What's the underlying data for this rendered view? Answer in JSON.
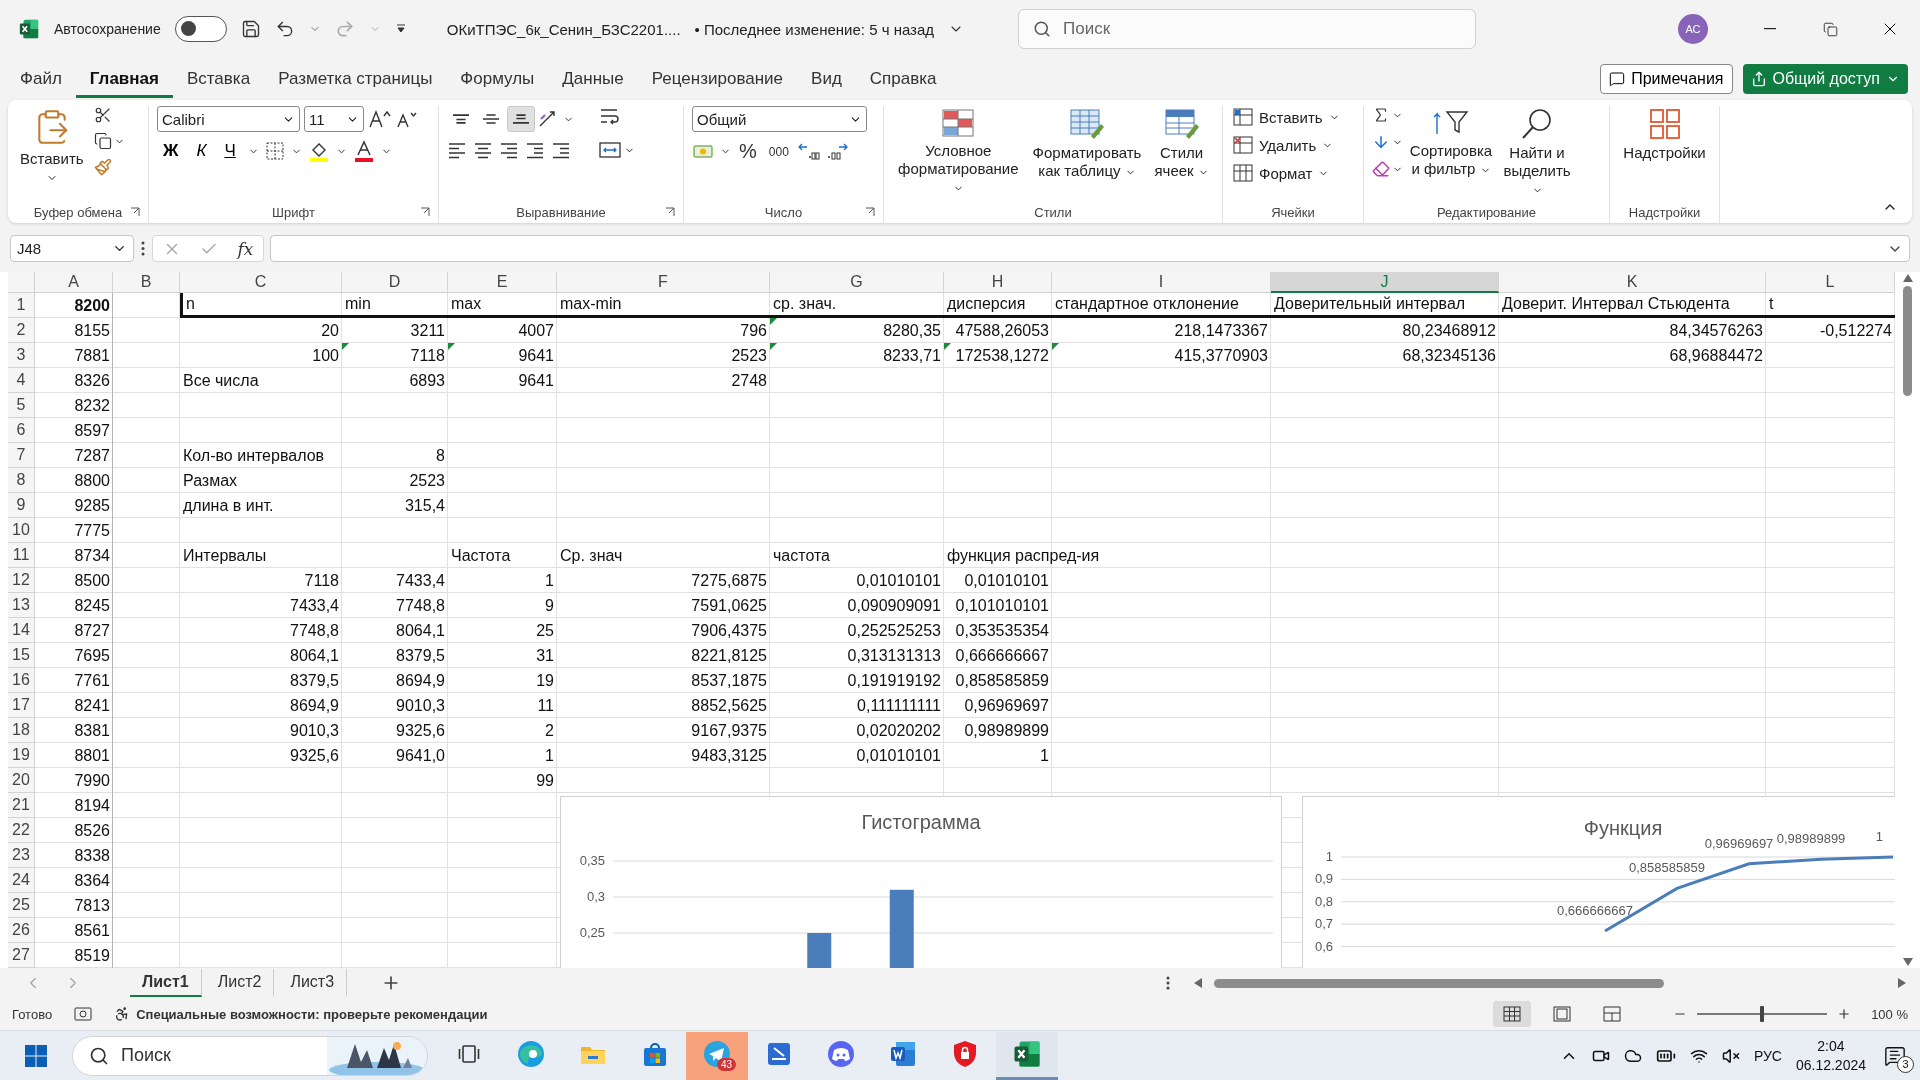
{
  "title_bar": {
    "autosave_label": "Автосохранение",
    "autosave_on": false,
    "document_title": "ОКиТПЭС_6к_Сенин_БЗС2201....",
    "last_modified": "• Последнее изменение: 5 ч назад",
    "search_placeholder": "Поиск",
    "avatar": "АС"
  },
  "menu": {
    "tabs": [
      {
        "label": "Файл",
        "selected": false
      },
      {
        "label": "Главная",
        "selected": true
      },
      {
        "label": "Вставка",
        "selected": false
      },
      {
        "label": "Разметка страницы",
        "selected": false
      },
      {
        "label": "Формулы",
        "selected": false
      },
      {
        "label": "Данные",
        "selected": false
      },
      {
        "label": "Рецензирование",
        "selected": false
      },
      {
        "label": "Вид",
        "selected": false
      },
      {
        "label": "Справка",
        "selected": false
      }
    ],
    "comments_button": "Примечания",
    "share_button": "Общий доступ"
  },
  "ribbon": {
    "clipboard": {
      "label": "Буфер обмена",
      "paste": "Вставить"
    },
    "font": {
      "label": "Шрифт",
      "name": "Calibri",
      "size": "11",
      "bold": "Ж",
      "italic": "К",
      "underline": "Ч"
    },
    "alignment": {
      "label": "Выравнивание",
      "vertical_buttons": [
        {
          "selected": false
        },
        {
          "selected": false
        },
        {
          "selected": true
        }
      ]
    },
    "number": {
      "label": "Число",
      "format": "Общий",
      "percent": "%",
      "thousands": "000"
    },
    "styles": {
      "label": "Стили",
      "buttons": [
        "Условное форматирование",
        "Форматировать как таблицу",
        "Стили ячеек"
      ]
    },
    "cells": {
      "label": "Ячейки",
      "buttons": [
        "Вставить",
        "Удалить",
        "Формат"
      ]
    },
    "editing": {
      "label": "Редактирование",
      "buttons": [
        "Сортировка и фильтр",
        "Найти и выделить"
      ]
    },
    "addins": {
      "label": "Надстройки",
      "button": "Надстройки"
    }
  },
  "formula_bar": {
    "name_box": "J48",
    "function_label": "fx"
  },
  "sheet": {
    "columns": [
      {
        "letter": "A",
        "selected": false
      },
      {
        "letter": "B",
        "selected": false
      },
      {
        "letter": "C",
        "selected": false
      },
      {
        "letter": "D",
        "selected": false
      },
      {
        "letter": "E",
        "selected": false
      },
      {
        "letter": "F",
        "selected": false
      },
      {
        "letter": "G",
        "selected": false
      },
      {
        "letter": "H",
        "selected": false
      },
      {
        "letter": "I",
        "selected": false
      },
      {
        "letter": "J",
        "selected": true
      },
      {
        "letter": "K",
        "selected": false
      },
      {
        "letter": "L",
        "selected": false
      }
    ],
    "rows": [
      {
        "number": "1",
        "header": true,
        "cells": [
          {
            "text": "8200",
            "bold": true
          },
          null,
          "n",
          "min",
          "max",
          "max-min",
          "ср. знач.",
          "дисперсия",
          "стандартное отклонение",
          "Доверительный интервал",
          "Доверит. Интервал Стьюдента",
          "t"
        ]
      },
      {
        "number": "2",
        "header": false,
        "cells": [
          "8155",
          null,
          "20",
          "3211",
          "4007",
          "796",
          {
            "text": "8280,35",
            "flag": true
          },
          "47588,26053",
          "218,1473367",
          "80,23468912",
          "84,34576263",
          "-0,512274"
        ]
      },
      {
        "number": "3",
        "header": false,
        "cells": [
          "7881",
          null,
          "100",
          {
            "text": "7118",
            "flag": true
          },
          {
            "text": "9641",
            "flag": true
          },
          "2523",
          {
            "text": "8233,71",
            "flag": true
          },
          {
            "text": "172538,1272",
            "flag": true
          },
          {
            "text": "415,3770903",
            "flag": true
          },
          "68,32345136",
          "68,96884472"
        ]
      },
      {
        "number": "4",
        "header": false,
        "cells": [
          "8326",
          null,
          "Все числа",
          "6893",
          "9641",
          "2748"
        ]
      },
      {
        "number": "5",
        "header": false,
        "cells": [
          "8232"
        ]
      },
      {
        "number": "6",
        "header": false,
        "cells": [
          "8597"
        ]
      },
      {
        "number": "7",
        "header": false,
        "cells": [
          "7287",
          null,
          "Кол-во интервалов",
          "8"
        ]
      },
      {
        "number": "8",
        "header": false,
        "cells": [
          "8800",
          null,
          "Размах",
          "2523"
        ]
      },
      {
        "number": "9",
        "header": false,
        "cells": [
          "9285",
          null,
          "длина в инт.",
          "315,4"
        ]
      },
      {
        "number": "10",
        "header": false,
        "cells": [
          "7775"
        ]
      },
      {
        "number": "11",
        "header": false,
        "cells": [
          "8734",
          null,
          "Интервалы",
          null,
          "Частота",
          "Ср. знач",
          "частота",
          "функция распред-ия"
        ]
      },
      {
        "number": "12",
        "header": false,
        "cells": [
          "8500",
          null,
          "7118",
          "7433,4",
          "1",
          "7275,6875",
          "0,01010101",
          "0,01010101"
        ]
      },
      {
        "number": "13",
        "header": false,
        "cells": [
          "8245",
          null,
          "7433,4",
          "7748,8",
          "9",
          "7591,0625",
          "0,090909091",
          "0,101010101"
        ]
      },
      {
        "number": "14",
        "header": false,
        "cells": [
          "8727",
          null,
          "7748,8",
          "8064,1",
          "25",
          "7906,4375",
          "0,252525253",
          "0,353535354"
        ]
      },
      {
        "number": "15",
        "header": false,
        "cells": [
          "7695",
          null,
          "8064,1",
          "8379,5",
          "31",
          "8221,8125",
          "0,313131313",
          "0,666666667"
        ]
      },
      {
        "number": "16",
        "header": false,
        "cells": [
          "7761",
          null,
          "8379,5",
          "8694,9",
          "19",
          "8537,1875",
          "0,191919192",
          "0,858585859"
        ]
      },
      {
        "number": "17",
        "header": false,
        "cells": [
          "8241",
          null,
          "8694,9",
          "9010,3",
          "11",
          "8852,5625",
          "0,111111111",
          "0,96969697"
        ]
      },
      {
        "number": "18",
        "header": false,
        "cells": [
          "8381",
          null,
          "9010,3",
          "9325,6",
          "2",
          "9167,9375",
          "0,02020202",
          "0,98989899"
        ]
      },
      {
        "number": "19",
        "header": false,
        "cells": [
          "8801",
          null,
          "9325,6",
          "9641,0",
          "1",
          "9483,3125",
          "0,01010101",
          "1"
        ]
      },
      {
        "number": "20",
        "header": false,
        "cells": [
          "7990",
          null,
          null,
          null,
          "99"
        ]
      },
      {
        "number": "21",
        "header": false,
        "cells": [
          "8194"
        ]
      },
      {
        "number": "22",
        "header": false,
        "cells": [
          "8526"
        ]
      },
      {
        "number": "23",
        "header": false,
        "cells": [
          "8338"
        ]
      },
      {
        "number": "24",
        "header": false,
        "cells": [
          "8364"
        ]
      },
      {
        "number": "25",
        "header": false,
        "cells": [
          "7813"
        ]
      },
      {
        "number": "26",
        "header": false,
        "cells": [
          "8561"
        ]
      },
      {
        "number": "27",
        "header": false,
        "cells": [
          "8519"
        ]
      }
    ],
    "charts": [
      {
        "chart_data": {
          "type": "bar",
          "title": "Гистограмма",
          "grid": true,
          "ylim": [
            0.2,
            0.35
          ],
          "series": [
            {
              "color": "#4a7ebb",
              "values": [
                null,
                null,
                0.25,
                0.31,
                null,
                null,
                null,
                null
              ]
            }
          ],
          "yticks": [
            {
              "value": 0.25,
              "label": "0,25"
            },
            {
              "value": 0.3,
              "label": "0,3"
            },
            {
              "value": 0.35,
              "label": "0,35"
            }
          ]
        }
      },
      {
        "chart_data": {
          "type": "line",
          "title": "Функция",
          "grid": true,
          "ylim": [
            0.5,
            1
          ],
          "series": [
            {
              "color": "#4a7ebb",
              "values": [
                null,
                null,
                null,
                0.67,
                0.86,
                0.97,
                0.99,
                1
              ]
            }
          ],
          "yticks": [
            {
              "value": 0.6,
              "label": "0,6"
            },
            {
              "value": 0.7,
              "label": "0,7"
            },
            {
              "value": 0.8,
              "label": "0,8"
            },
            {
              "value": 0.9,
              "label": "0,9"
            },
            {
              "value": 1,
              "label": "1"
            }
          ],
          "value_labels": [
            null,
            null,
            null,
            "0,666666667",
            "0,858585859",
            "0,96969697",
            "0,98989899",
            "1"
          ]
        }
      }
    ]
  },
  "sheet_tabs": [
    {
      "label": "Лист1",
      "selected": true
    },
    {
      "label": "Лист2",
      "selected": false
    },
    {
      "label": "Лист3",
      "selected": false
    }
  ],
  "status_bar": {
    "status": "Готово",
    "accessibility": "Специальные возможности: проверьте рекомендации",
    "views": [
      {
        "kind": "normal",
        "selected": true
      },
      {
        "kind": "page-layout",
        "selected": false
      },
      {
        "kind": "page-break",
        "selected": false
      }
    ],
    "zoom": {
      "level": 0.5,
      "reading": "100 %"
    }
  },
  "taskbar": {
    "search_placeholder": "Поиск",
    "apps": [
      {
        "kind": "task-view",
        "active": false,
        "flashing": false
      },
      {
        "kind": "edge",
        "active": false,
        "flashing": false
      },
      {
        "kind": "explorer",
        "active": false,
        "flashing": false
      },
      {
        "kind": "store",
        "active": false,
        "flashing": false
      },
      {
        "kind": "telegram",
        "active": false,
        "flashing": true,
        "badge": "43"
      },
      {
        "kind": "scanner",
        "active": false,
        "flashing": false
      },
      {
        "kind": "discord",
        "active": false,
        "flashing": false
      },
      {
        "kind": "word",
        "active": false,
        "flashing": false
      },
      {
        "kind": "shield",
        "active": false,
        "flashing": false
      },
      {
        "kind": "excel",
        "active": true,
        "flashing": false
      }
    ],
    "language": "РУС",
    "time": "2:04",
    "date": "06.12.2024",
    "notifications": "3"
  }
}
